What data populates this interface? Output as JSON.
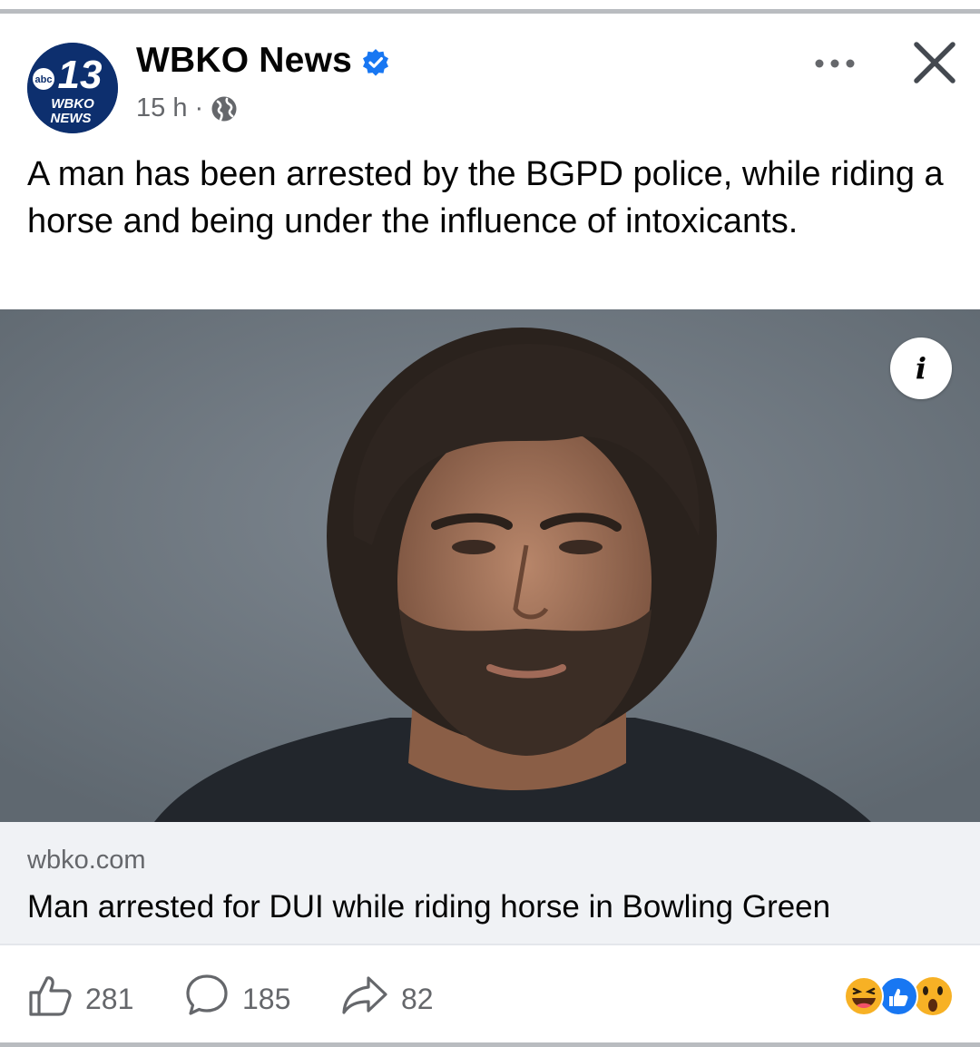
{
  "post": {
    "page_name": "WBKO News",
    "timestamp": "15 h",
    "separator": "·",
    "privacy_icon": "globe-icon",
    "verified_icon": "verified-badge-icon",
    "caption": "A man has been arrested by the BGPD police, while riding a horse and being under the influence of intoxicants."
  },
  "avatar": {
    "network": "abc",
    "channel": "13",
    "line1": "WBKO",
    "line2": "NEWS"
  },
  "link": {
    "domain": "wbko.com",
    "title": "Man arrested for DUI while riding horse in Bowling Green"
  },
  "image": {
    "info_label": "i"
  },
  "actions": {
    "likes": "281",
    "comments": "185",
    "shares": "82"
  },
  "reactions": [
    "haha-icon",
    "like-icon",
    "wow-icon"
  ],
  "colors": {
    "accent": "#1877f2",
    "text": "#050505",
    "muted": "#65676b",
    "card_bg": "#f0f2f5"
  }
}
